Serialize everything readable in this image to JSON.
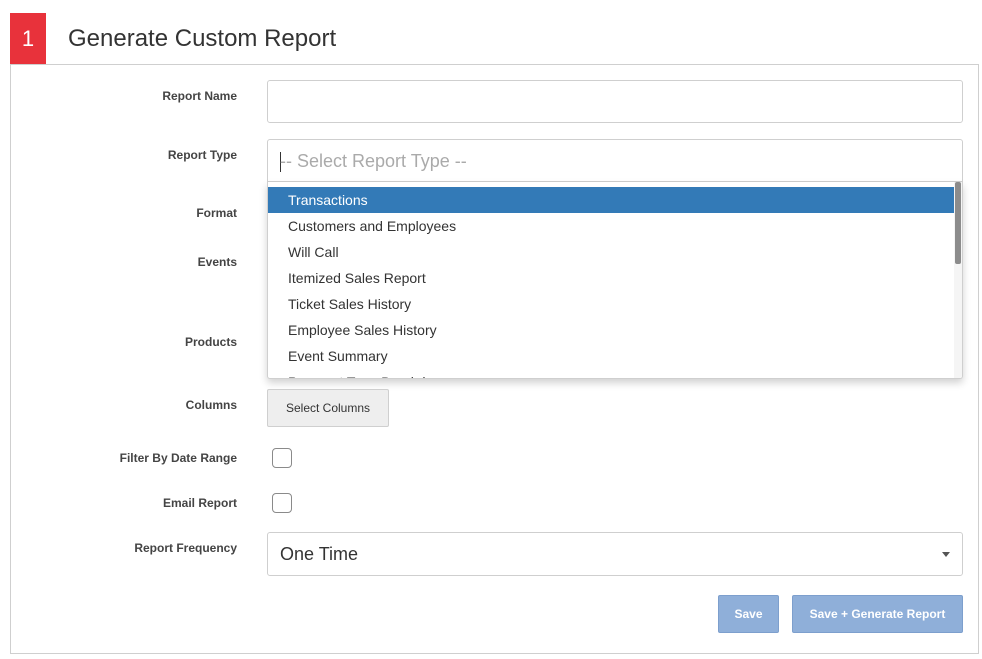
{
  "header": {
    "step": "1",
    "title": "Generate Custom Report"
  },
  "form": {
    "report_name": {
      "label": "Report Name",
      "value": ""
    },
    "report_type": {
      "label": "Report Type",
      "placeholder": "-- Select Report Type --",
      "options": [
        "Transactions",
        "Customers and Employees",
        "Will Call",
        "Itemized Sales Report",
        "Ticket Sales History",
        "Employee Sales History",
        "Event Summary",
        "Payment Type Breakdown"
      ],
      "highlighted": "Transactions"
    },
    "format": {
      "label": "Format"
    },
    "events": {
      "label": "Events"
    },
    "products": {
      "label": "Products"
    },
    "columns": {
      "label": "Columns",
      "button": "Select Columns"
    },
    "filter_date": {
      "label": "Filter By Date Range",
      "checked": false
    },
    "email_report": {
      "label": "Email Report",
      "checked": false
    },
    "frequency": {
      "label": "Report Frequency",
      "value": "One Time"
    }
  },
  "actions": {
    "save": "Save",
    "save_generate": "Save + Generate Report"
  },
  "colors": {
    "accent_red": "#e8323b",
    "highlight_blue": "#337ab7",
    "button_blue": "#8fafd9"
  }
}
